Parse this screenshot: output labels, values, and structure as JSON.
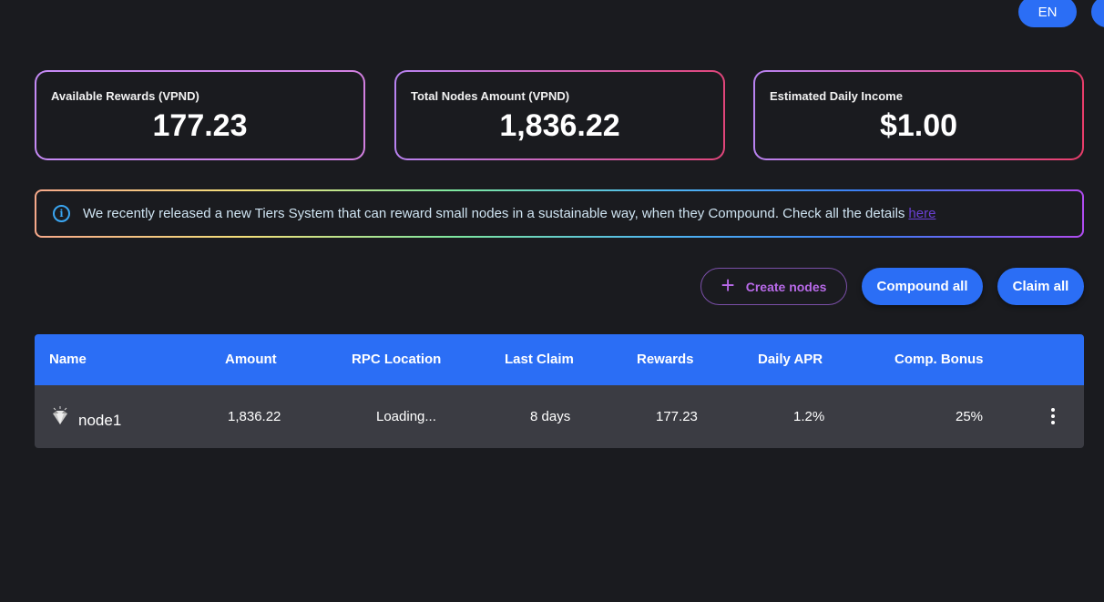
{
  "topbar": {
    "language": "EN"
  },
  "stats": [
    {
      "label": "Available Rewards (VPND)",
      "value": "177.23"
    },
    {
      "label": "Total Nodes Amount (VPND)",
      "value": "1,836.22"
    },
    {
      "label": "Estimated Daily Income",
      "value": "$1.00"
    }
  ],
  "banner": {
    "text": "We recently released a new Tiers System that can reward small nodes in a sustainable way, when they Compound. Check all the details",
    "link": "here"
  },
  "actions": {
    "create": "Create nodes",
    "compound": "Compound all",
    "claim": "Claim all"
  },
  "table": {
    "headers": [
      "Name",
      "Amount",
      "RPC Location",
      "Last Claim",
      "Rewards",
      "Daily APR",
      "Comp. Bonus"
    ],
    "rows": [
      {
        "name": "node1",
        "amount": "1,836.22",
        "rpc": "Loading...",
        "last_claim": "8 days",
        "rewards": "177.23",
        "apr": "1.2%",
        "bonus": "25%",
        "icon": "diamond-icon"
      }
    ]
  },
  "colors": {
    "accent": "#2b6ef5",
    "background": "#1a1b1f",
    "row": "#3b3c43",
    "link": "#6a3fd4"
  }
}
